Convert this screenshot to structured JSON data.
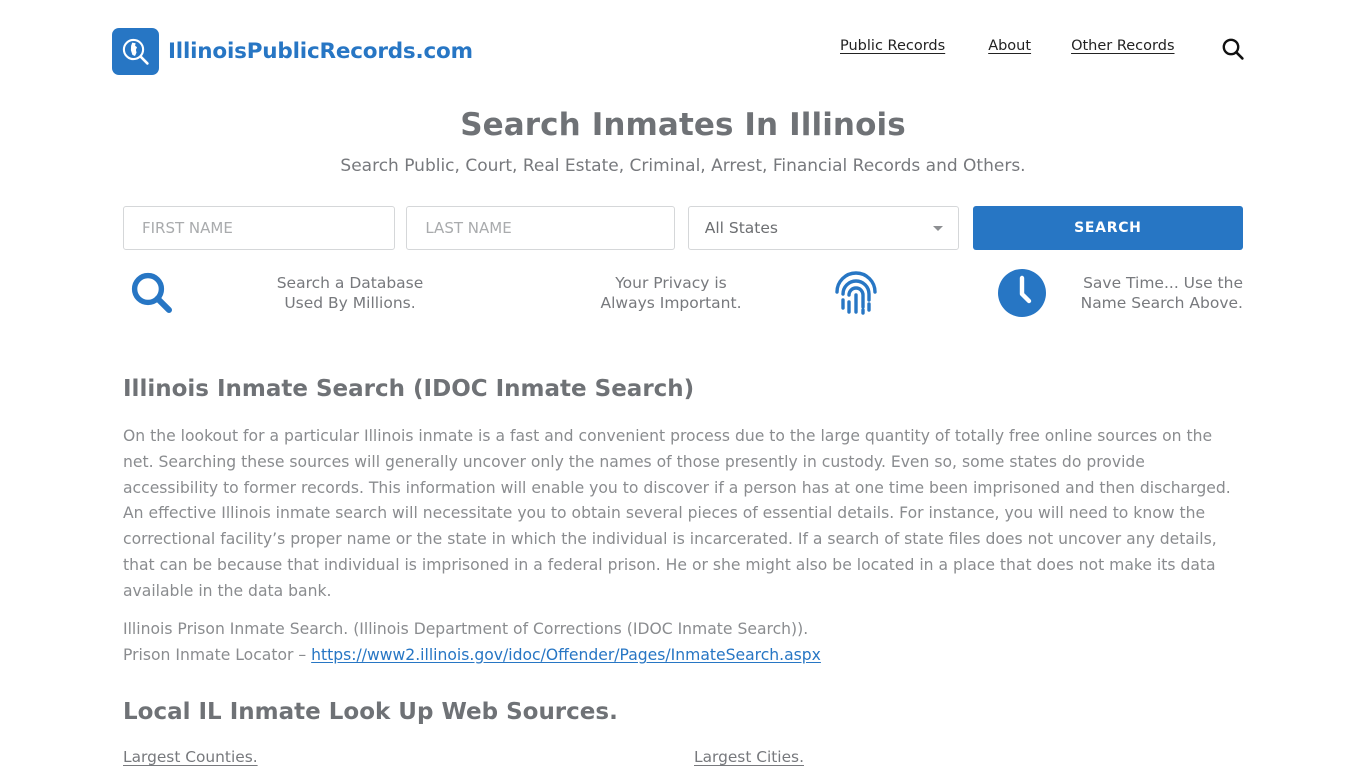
{
  "header": {
    "brand_name": "IllinoisPublicRecords.com",
    "brand_icon": "magnifier-illinois-logo-icon",
    "nav": [
      {
        "label": "Public Records"
      },
      {
        "label": "About"
      },
      {
        "label": "Other Records"
      }
    ],
    "search_icon": "search-icon"
  },
  "hero": {
    "title": "Search Inmates In Illinois",
    "subtitle": "Search Public, Court, Real Estate, Criminal, Arrest, Financial Records and Others."
  },
  "search_form": {
    "first_name": {
      "value": "",
      "placeholder": "FIRST NAME"
    },
    "last_name": {
      "value": "",
      "placeholder": "LAST NAME"
    },
    "state": {
      "selected": "All States",
      "options": [
        "All States"
      ]
    },
    "submit_label": "SEARCH",
    "submit_color": "#2776c4"
  },
  "features": [
    {
      "icon": "search-icon",
      "line1": "Search a Database",
      "line2": "Used By Millions."
    },
    {
      "icon": "fingerprint-icon",
      "line1": "Your Privacy is",
      "line2": "Always Important."
    },
    {
      "icon": "clock-icon",
      "line1": "Save Time... Use the",
      "line2": "Name Search Above."
    }
  ],
  "article": {
    "heading": "Illinois Inmate Search (IDOC Inmate Search)",
    "body": "On the lookout for a particular Illinois inmate is a fast and convenient process due to the large quantity of totally free online sources on the net. Searching these sources will generally uncover only the names of those presently in custody. Even so, some states do provide accessibility to former records. This information will enable you to discover if a person has at one time been imprisoned and then discharged. An effective Illinois inmate search will necessitate you to obtain several pieces of essential details. For instance, you will need to know the correctional facility’s proper name or the state in which the individual is incarcerated. If a search of state files does not uncover any details, that can be because that individual is imprisoned in a federal prison. He or she might also be located in a place that does not make its data available in the data bank.",
    "source_line": "Illinois Prison Inmate Search. (Illinois Department of Corrections (IDOC Inmate Search)).",
    "locator_label": "Prison Inmate Locator – ",
    "locator_url": "https://www2.illinois.gov/idoc/Offender/Pages/InmateSearch.aspx"
  },
  "local_sources": {
    "heading": "Local IL Inmate Look Up Web Sources.",
    "counties_link": "Largest Counties.",
    "cities_link": "Largest Cities."
  },
  "colors": {
    "brand_blue": "#2776c4",
    "heading_gray": "#6f7276",
    "body_gray": "#8a8c8f"
  }
}
